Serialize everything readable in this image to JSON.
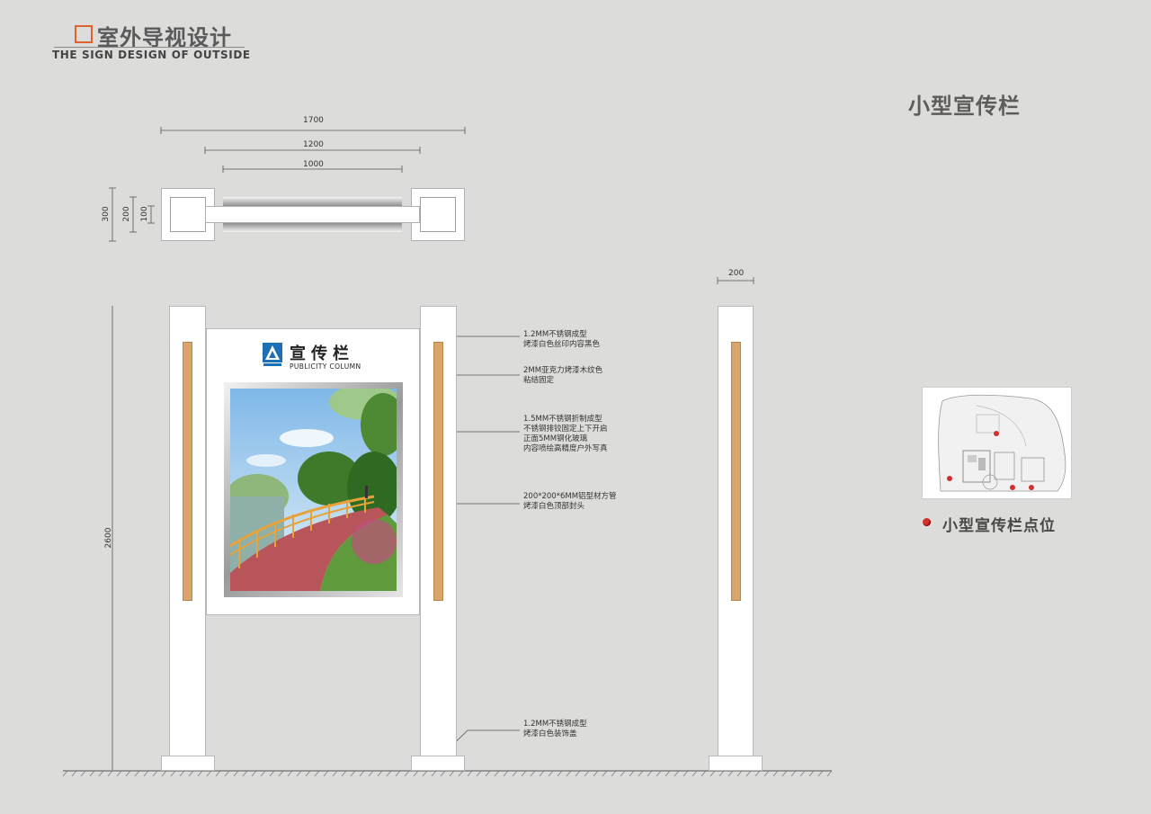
{
  "header": {
    "title_cn": "室外导视设计",
    "title_en": "THE SIGN DESIGN OF OUTSIDE"
  },
  "section_title": "小型宣传栏",
  "dimensions": {
    "top_width_total": "1700",
    "top_width_board": "1200",
    "top_width_inner": "1000",
    "depth_300": "300",
    "depth_200": "200",
    "depth_100": "100",
    "height": "2600",
    "post_width": "200"
  },
  "board": {
    "name": "宣传栏",
    "name_en": "PUBLICITY COLUMN"
  },
  "callouts": [
    {
      "lines": [
        "1.2MM不锈钢成型",
        "烤漆白色丝印内容黑色"
      ]
    },
    {
      "lines": [
        "2MM亚克力烤漆木纹色",
        "粘结固定"
      ]
    },
    {
      "lines": [
        "1.5MM不锈钢折制成型",
        "不锈钢排铰固定上下开启",
        "正面5MM钢化玻璃",
        "内容喷绘高精度户外写真"
      ]
    },
    {
      "lines": [
        "200*200*6MM铝型材方管",
        "烤漆白色顶部封头"
      ]
    },
    {
      "lines": [
        "1.2MM不锈钢成型",
        "烤漆白色装饰盖"
      ]
    }
  ],
  "legend": {
    "label": "小型宣传栏点位",
    "marker_color": "#d32f2f"
  },
  "colors": {
    "accent": "#e0622c",
    "wood": "#d9a56a",
    "background": "#dcdcda",
    "path": "#b8555a",
    "grass": "#5f9a3c"
  }
}
